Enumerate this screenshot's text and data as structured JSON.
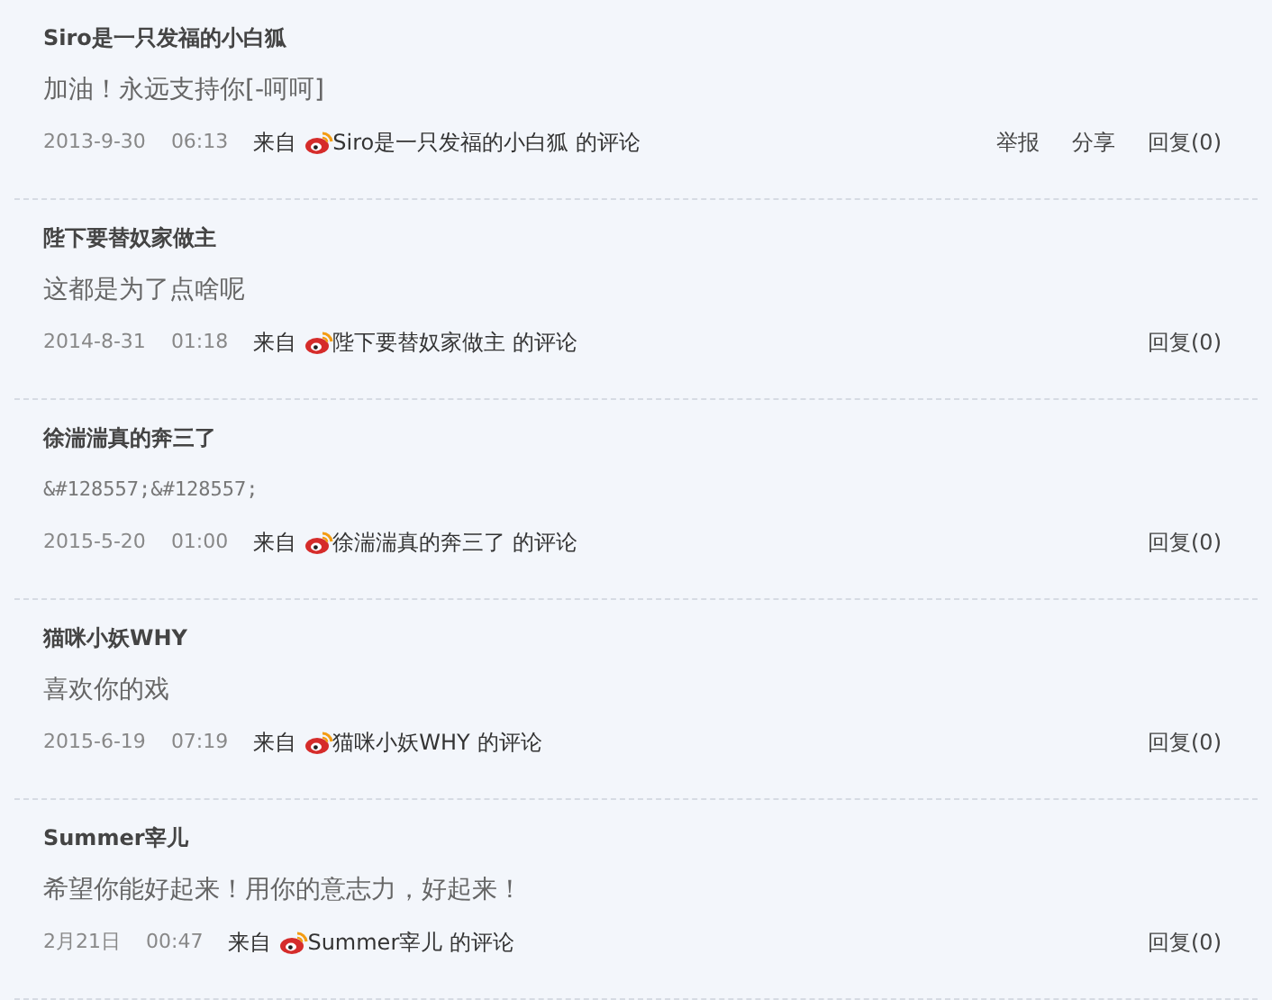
{
  "comments": [
    {
      "kind": "text",
      "author": "Siro是一只发福的小白狐",
      "body": "加油！永远支持你[-呵呵]",
      "date": "2013-9-30",
      "time": "06:13",
      "from": "来自",
      "source": "Siro是一只发福的小白狐",
      "suffix": "的评论",
      "actions": [
        "举报",
        "分享",
        "回复(0)"
      ]
    },
    {
      "kind": "text",
      "author": "陛下要替奴家做主",
      "body": "这都是为了点啥呢",
      "date": "2014-8-31",
      "time": "01:18",
      "from": "来自",
      "source": "陛下要替奴家做主",
      "suffix": "的评论",
      "actions": [
        "回复(0)"
      ]
    },
    {
      "kind": "raw",
      "author": "徐湍湍真的奔三了",
      "body": "&#128557;&#128557;",
      "date": "2015-5-20",
      "time": "01:00",
      "from": "来自",
      "source": "徐湍湍真的奔三了",
      "suffix": "的评论",
      "actions": [
        "回复(0)"
      ]
    },
    {
      "kind": "text",
      "author": "猫咪小妖WHY",
      "body": "喜欢你的戏",
      "date": "2015-6-19",
      "time": "07:19",
      "from": "来自",
      "source": "猫咪小妖WHY",
      "suffix": "的评论",
      "actions": [
        "回复(0)"
      ]
    },
    {
      "kind": "text",
      "author": "Summer宰儿",
      "body": "希望你能好起来！用你的意志力，好起来！",
      "date": "2月21日",
      "time": "00:47",
      "from": "来自",
      "source": "Summer宰儿",
      "suffix": "的评论",
      "actions": [
        "回复(0)"
      ]
    }
  ]
}
